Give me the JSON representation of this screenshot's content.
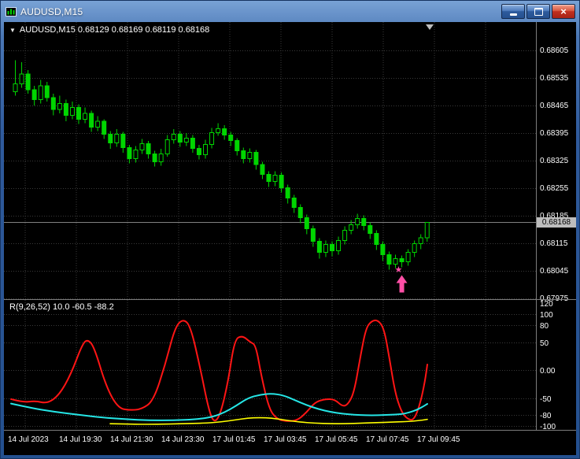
{
  "titlebar": {
    "title": "AUDUSD,M15",
    "close_glyph": "×"
  },
  "main_chart": {
    "dropdown_glyph": "▼",
    "overlay_label": "AUDUSD,M15  0.68129 0.68169 0.68119 0.68168",
    "current_price": "0.68168"
  },
  "indicator_panel": {
    "label": "R(9,26,52) 10.0 -60.5 -88.2",
    "axis_labels": [
      "120",
      "100",
      "80",
      "50",
      "0.00",
      "-50",
      "-80",
      "-100"
    ],
    "levels": [
      100,
      80,
      50,
      0,
      -50,
      -80,
      -100
    ]
  },
  "chart_data": {
    "type": "candlestick",
    "symbol": "AUDUSD",
    "timeframe": "M15",
    "last_ohlc": {
      "open": "0.68129",
      "high": "0.68169",
      "low": "0.68119",
      "close": "0.68168"
    },
    "price_axis": [
      "0.68605",
      "0.68535",
      "0.68465",
      "0.68395",
      "0.68325",
      "0.68255",
      "0.68185",
      "0.68115",
      "0.68045",
      "0.67975"
    ],
    "time_axis": [
      "14 Jul 2023",
      "14 Jul 19:30",
      "14 Jul 21:30",
      "14 Jul 23:30",
      "17 Jul 01:45",
      "17 Jul 03:45",
      "17 Jul 05:45",
      "17 Jul 07:45",
      "17 Jul 09:45"
    ],
    "candles": [
      [
        0.685,
        0.6858,
        0.6849,
        0.6852
      ],
      [
        0.6852,
        0.68575,
        0.6851,
        0.68545
      ],
      [
        0.68545,
        0.68555,
        0.68495,
        0.68505
      ],
      [
        0.68505,
        0.68515,
        0.68465,
        0.6848
      ],
      [
        0.6848,
        0.6853,
        0.6847,
        0.68515
      ],
      [
        0.68515,
        0.68525,
        0.68475,
        0.68485
      ],
      [
        0.68485,
        0.68495,
        0.6844,
        0.68455
      ],
      [
        0.68455,
        0.6849,
        0.68445,
        0.6847
      ],
      [
        0.6847,
        0.6848,
        0.68425,
        0.6844
      ],
      [
        0.6844,
        0.68475,
        0.6843,
        0.6846
      ],
      [
        0.6846,
        0.68468,
        0.68418,
        0.6843
      ],
      [
        0.6843,
        0.6846,
        0.6842,
        0.68445
      ],
      [
        0.68445,
        0.68452,
        0.68398,
        0.6841
      ],
      [
        0.6841,
        0.68438,
        0.684,
        0.68425
      ],
      [
        0.68425,
        0.6843,
        0.6838,
        0.68392
      ],
      [
        0.68392,
        0.684,
        0.68355,
        0.6837
      ],
      [
        0.6837,
        0.68405,
        0.6836,
        0.68392
      ],
      [
        0.68392,
        0.68398,
        0.68345,
        0.68358
      ],
      [
        0.68358,
        0.68365,
        0.68318,
        0.6833
      ],
      [
        0.6833,
        0.68362,
        0.6832,
        0.68352
      ],
      [
        0.68352,
        0.6838,
        0.68342,
        0.68368
      ],
      [
        0.68368,
        0.68375,
        0.6833,
        0.68342
      ],
      [
        0.68342,
        0.6835,
        0.6831,
        0.68322
      ],
      [
        0.68322,
        0.68355,
        0.68312,
        0.68342
      ],
      [
        0.68342,
        0.6839,
        0.68335,
        0.68378
      ],
      [
        0.68378,
        0.68405,
        0.68368,
        0.68392
      ],
      [
        0.68392,
        0.684,
        0.6836,
        0.68372
      ],
      [
        0.68372,
        0.68395,
        0.68362,
        0.68382
      ],
      [
        0.68382,
        0.6839,
        0.68345,
        0.68356
      ],
      [
        0.68356,
        0.68365,
        0.68328,
        0.6834
      ],
      [
        0.6834,
        0.68378,
        0.6833,
        0.68366
      ],
      [
        0.68366,
        0.68408,
        0.68356,
        0.68396
      ],
      [
        0.68396,
        0.6842,
        0.68388,
        0.68406
      ],
      [
        0.68406,
        0.68415,
        0.68378,
        0.6839
      ],
      [
        0.6839,
        0.68398,
        0.68362,
        0.68376
      ],
      [
        0.68376,
        0.68382,
        0.68338,
        0.6835
      ],
      [
        0.6835,
        0.68358,
        0.68318,
        0.6833
      ],
      [
        0.6833,
        0.68356,
        0.6832,
        0.68346
      ],
      [
        0.68346,
        0.68352,
        0.68302,
        0.68315
      ],
      [
        0.68315,
        0.68322,
        0.68278,
        0.6829
      ],
      [
        0.6829,
        0.68298,
        0.68258,
        0.68272
      ],
      [
        0.68272,
        0.68298,
        0.6826,
        0.68288
      ],
      [
        0.68288,
        0.68295,
        0.68244,
        0.68256
      ],
      [
        0.68256,
        0.68264,
        0.68216,
        0.6823
      ],
      [
        0.6823,
        0.68238,
        0.68192,
        0.68206
      ],
      [
        0.68206,
        0.68214,
        0.68166,
        0.6818
      ],
      [
        0.6818,
        0.68188,
        0.68138,
        0.68152
      ],
      [
        0.68152,
        0.6816,
        0.68106,
        0.6812
      ],
      [
        0.6812,
        0.68128,
        0.68076,
        0.68092
      ],
      [
        0.68092,
        0.68122,
        0.6808,
        0.68112
      ],
      [
        0.68112,
        0.6812,
        0.68082,
        0.68096
      ],
      [
        0.68096,
        0.68132,
        0.68086,
        0.68122
      ],
      [
        0.68122,
        0.68158,
        0.68112,
        0.68148
      ],
      [
        0.68148,
        0.68174,
        0.68138,
        0.68162
      ],
      [
        0.68162,
        0.6819,
        0.68152,
        0.68178
      ],
      [
        0.68178,
        0.68186,
        0.68148,
        0.6816
      ],
      [
        0.6816,
        0.68168,
        0.68126,
        0.6814
      ],
      [
        0.6814,
        0.68148,
        0.68098,
        0.68112
      ],
      [
        0.68112,
        0.6812,
        0.6807,
        0.68086
      ],
      [
        0.68086,
        0.68094,
        0.68048,
        0.68062
      ],
      [
        0.68062,
        0.68086,
        0.68052,
        0.68076
      ],
      [
        0.68076,
        0.68084,
        0.68054,
        0.68068
      ],
      [
        0.68068,
        0.681,
        0.68058,
        0.68092
      ],
      [
        0.68092,
        0.68122,
        0.6808,
        0.68114
      ],
      [
        0.68114,
        0.68138,
        0.681,
        0.68129
      ],
      [
        0.68129,
        0.68169,
        0.68119,
        0.68168
      ]
    ],
    "oscillator": {
      "name": "R(9,26,52)",
      "current_values": [
        10.0,
        -60.5,
        -88.2
      ],
      "range": [
        120,
        -100
      ],
      "series": [
        {
          "name": "main",
          "color": "#ff1515",
          "width": 2,
          "points": [
            [
              9,
              -52
            ],
            [
              25,
              -58
            ],
            [
              40,
              -55
            ],
            [
              55,
              -60
            ],
            [
              70,
              -45
            ],
            [
              85,
              -8
            ],
            [
              100,
              48
            ],
            [
              107,
              55
            ],
            [
              115,
              40
            ],
            [
              130,
              -30
            ],
            [
              145,
              -68
            ],
            [
              160,
              -72
            ],
            [
              175,
              -70
            ],
            [
              190,
              -55
            ],
            [
              205,
              10
            ],
            [
              217,
              75
            ],
            [
              227,
              92
            ],
            [
              237,
              80
            ],
            [
              250,
              0
            ],
            [
              260,
              -70
            ],
            [
              267,
              -95
            ],
            [
              275,
              -80
            ],
            [
              285,
              -20
            ],
            [
              293,
              55
            ],
            [
              303,
              62
            ],
            [
              313,
              50
            ],
            [
              320,
              45
            ],
            [
              327,
              -10
            ],
            [
              337,
              -70
            ],
            [
              347,
              -88
            ],
            [
              360,
              -92
            ],
            [
              373,
              -90
            ],
            [
              385,
              -75
            ],
            [
              395,
              -58
            ],
            [
              407,
              -52
            ],
            [
              420,
              -52
            ],
            [
              430,
              -65
            ],
            [
              437,
              -62
            ],
            [
              445,
              -40
            ],
            [
              453,
              25
            ],
            [
              460,
              75
            ],
            [
              467,
              88
            ],
            [
              475,
              90
            ],
            [
              483,
              75
            ],
            [
              490,
              20
            ],
            [
              497,
              -40
            ],
            [
              505,
              -75
            ],
            [
              513,
              -88
            ],
            [
              521,
              -90
            ],
            [
              529,
              -60
            ],
            [
              535,
              -20
            ],
            [
              538,
              10
            ]
          ]
        },
        {
          "name": "signal",
          "color": "#25e6e6",
          "width": 2,
          "points": [
            [
              9,
              -60
            ],
            [
              35,
              -68
            ],
            [
              65,
              -75
            ],
            [
              95,
              -80
            ],
            [
              125,
              -85
            ],
            [
              155,
              -88
            ],
            [
              185,
              -90
            ],
            [
              215,
              -90
            ],
            [
              245,
              -88
            ],
            [
              265,
              -84
            ],
            [
              280,
              -76
            ],
            [
              295,
              -64
            ],
            [
              310,
              -50
            ],
            [
              325,
              -44
            ],
            [
              340,
              -42
            ],
            [
              355,
              -45
            ],
            [
              370,
              -54
            ],
            [
              385,
              -63
            ],
            [
              400,
              -70
            ],
            [
              415,
              -75
            ],
            [
              430,
              -78
            ],
            [
              445,
              -80
            ],
            [
              460,
              -81
            ],
            [
              475,
              -81
            ],
            [
              490,
              -80
            ],
            [
              505,
              -79
            ],
            [
              515,
              -76
            ],
            [
              525,
              -71
            ],
            [
              533,
              -65
            ],
            [
              538,
              -60.5
            ]
          ]
        },
        {
          "name": "base",
          "color": "#ffff00",
          "width": 1.6,
          "points": [
            [
              135,
              -96
            ],
            [
              165,
              -97
            ],
            [
              195,
              -97
            ],
            [
              225,
              -96
            ],
            [
              255,
              -95
            ],
            [
              275,
              -93
            ],
            [
              295,
              -89
            ],
            [
              310,
              -86
            ],
            [
              325,
              -85
            ],
            [
              340,
              -86
            ],
            [
              355,
              -89
            ],
            [
              375,
              -93
            ],
            [
              395,
              -95
            ],
            [
              415,
              -96
            ],
            [
              435,
              -96
            ],
            [
              455,
              -95
            ],
            [
              475,
              -94
            ],
            [
              495,
              -93
            ],
            [
              515,
              -92
            ],
            [
              530,
              -90
            ],
            [
              538,
              -88.2
            ]
          ]
        }
      ]
    },
    "annotation": {
      "type": "buy-signal",
      "star_glyph": "★",
      "color": "#ff4fa6",
      "candle_index": 61,
      "star_price": 0.68049,
      "arrow_top_price": 0.68034
    }
  },
  "colors": {
    "background": "#000000",
    "grid": "#3a3a3a",
    "candle": "#00d600",
    "bull_fill": "#000000",
    "bid_line": "#808080",
    "separator": "#7d7d7d",
    "axis_text": "#ffffff",
    "price_tag_bg": "#bdbdbd",
    "price_tag_text": "#000000",
    "shift_marker": "#bdbdbd"
  }
}
